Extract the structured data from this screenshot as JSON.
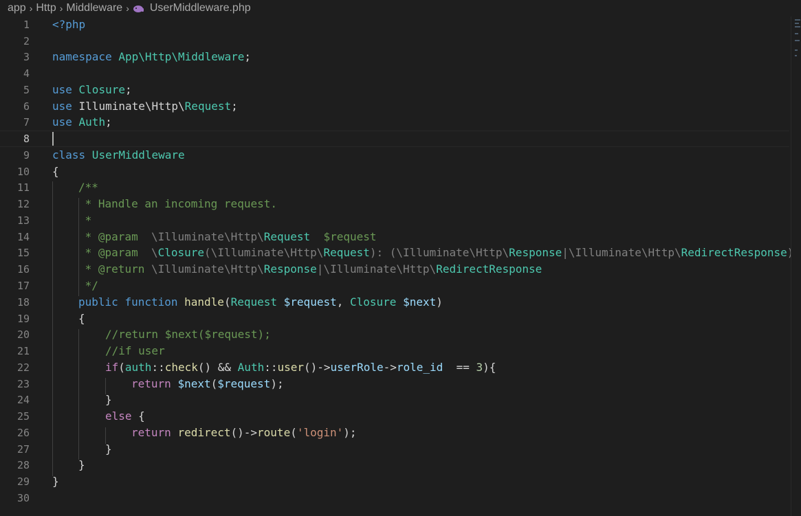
{
  "breadcrumb": {
    "items": [
      "app",
      "Http",
      "Middleware"
    ],
    "file": "UserMiddleware.php"
  },
  "editor": {
    "line_numbers": [
      "1",
      "2",
      "3",
      "4",
      "5",
      "6",
      "7",
      "8",
      "9",
      "10",
      "11",
      "12",
      "13",
      "14",
      "15",
      "16",
      "17",
      "18",
      "19",
      "20",
      "21",
      "22",
      "23",
      "24",
      "25",
      "26",
      "27",
      "28",
      "29",
      "30"
    ],
    "current_line": "8",
    "tokens": {
      "l1": [
        "<?php"
      ],
      "l3": [
        "namespace",
        " App\\Http\\Middleware",
        ";"
      ],
      "l5": [
        "use",
        " Closure",
        ";"
      ],
      "l6": [
        "use",
        " Illuminate\\Http\\",
        "Request",
        ";"
      ],
      "l7": [
        "use",
        " Auth",
        ";"
      ],
      "l9": [
        "class",
        " UserMiddleware"
      ],
      "l10": [
        "{"
      ],
      "l11": [
        "/**"
      ],
      "l12": [
        " * Handle an incoming request."
      ],
      "l13": [
        " *"
      ],
      "l14": [
        " * ",
        "@param",
        "  \\Illuminate\\Http\\",
        "Request",
        "  $request"
      ],
      "l15": [
        " * ",
        "@param",
        "  \\",
        "Closure",
        "(\\Illuminate\\Http\\",
        "Request",
        "): (\\Illuminate\\Http\\",
        "Response",
        "|\\Illuminate\\Http\\",
        "RedirectResponse",
        ")"
      ],
      "l16": [
        " * ",
        "@return",
        " \\Illuminate\\Http\\",
        "Response",
        "|\\Illuminate\\Http\\",
        "RedirectResponse"
      ],
      "l17": [
        " */"
      ],
      "l18": [
        "public",
        " ",
        "function",
        " ",
        "handle",
        "(",
        "Request",
        " ",
        "$request",
        ", ",
        "Closure",
        " ",
        "$next",
        ")"
      ],
      "l19": [
        "{"
      ],
      "l20": [
        "//return $next($request);"
      ],
      "l21": [
        "//if user"
      ],
      "l22": [
        "if",
        "(",
        "auth",
        "::",
        "check",
        "() && ",
        "Auth",
        "::",
        "user",
        "()->",
        "userRole",
        "->",
        "role_id",
        "  == ",
        "3",
        "){"
      ],
      "l23": [
        "return",
        " ",
        "$next",
        "(",
        "$request",
        ");"
      ],
      "l24": [
        "}"
      ],
      "l25": [
        "else",
        " {"
      ],
      "l26": [
        "return",
        " ",
        "redirect",
        "()->",
        "route",
        "(",
        "'login'",
        ");"
      ],
      "l27": [
        "}"
      ],
      "l28": [
        "}"
      ],
      "l29": [
        "}"
      ]
    }
  },
  "colors": {
    "background": "#1e1e1e",
    "keyword": "#569cd6",
    "control": "#c586c0",
    "type": "#4ec9b0",
    "function": "#dcdcaa",
    "variable": "#9cdcfe",
    "comment": "#6a9955",
    "string": "#ce9178",
    "number": "#b5cea8"
  }
}
